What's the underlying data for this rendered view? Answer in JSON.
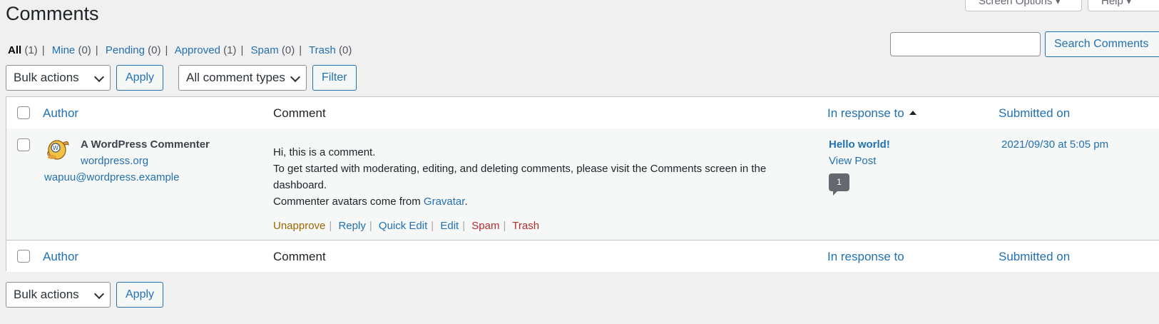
{
  "top_buttons": {
    "screen_options": "Screen Options ▾",
    "help": "Help ▾"
  },
  "page": {
    "title": "Comments"
  },
  "filters": [
    {
      "label": "All",
      "count": "(1)"
    },
    {
      "label": "Mine",
      "count": "(0)"
    },
    {
      "label": "Pending",
      "count": "(0)"
    },
    {
      "label": "Approved",
      "count": "(1)"
    },
    {
      "label": "Spam",
      "count": "(0)"
    },
    {
      "label": "Trash",
      "count": "(0)"
    }
  ],
  "search": {
    "value": "",
    "button_label": "Search Comments"
  },
  "tablenav_top": {
    "bulk_actions": "Bulk actions",
    "apply": "Apply",
    "comment_types": "All comment types",
    "filter": "Filter"
  },
  "tablenav_bottom": {
    "bulk_actions": "Bulk actions",
    "apply": "Apply"
  },
  "columns": {
    "author": "Author",
    "comment": "Comment",
    "in_response_to": "In response to",
    "submitted_on": "Submitted on"
  },
  "comment": {
    "author_name": "A WordPress Commenter",
    "author_url": "wordpress.org",
    "author_email": "wapuu@wordpress.example",
    "text_line1": "Hi, this is a comment.",
    "text_line2": "To get started with moderating, editing, and deleting comments, please visit the Comments screen in the dashboard.",
    "text_line3_prefix": "Commenter avatars come from ",
    "text_line3_link": "Gravatar",
    "text_line3_suffix": ".",
    "actions": {
      "unapprove": "Unapprove",
      "reply": "Reply",
      "quick_edit": "Quick Edit",
      "edit": "Edit",
      "spam": "Spam",
      "trash": "Trash"
    },
    "response_title": "Hello world!",
    "view_post": "View Post",
    "comment_count": "1",
    "submitted": "2021/09/30 at 5:05 pm"
  }
}
